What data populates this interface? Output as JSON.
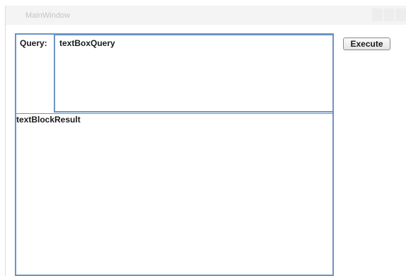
{
  "window": {
    "title": "MainWindow"
  },
  "query": {
    "label": "Query:",
    "value": "textBoxQuery"
  },
  "toolbar": {
    "execute_label": "Execute"
  },
  "result": {
    "text": "textBlockResult"
  },
  "colors": {
    "border": "#6d93c4",
    "titlebar": "#f4f4f4",
    "title_text": "#c4c4c4"
  }
}
